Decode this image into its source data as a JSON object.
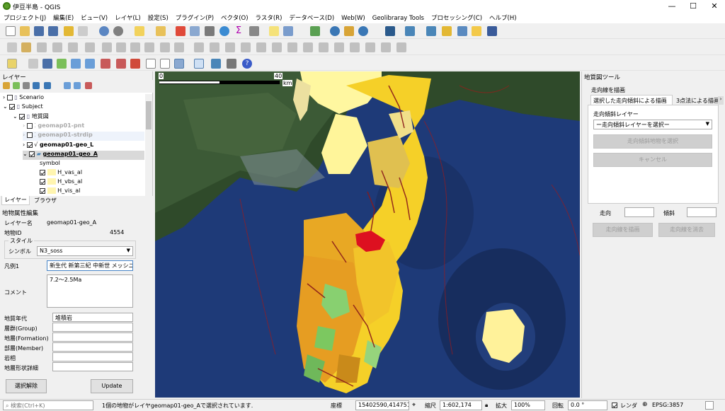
{
  "window": {
    "title": "伊豆半島 - QGIS",
    "minimize": "—",
    "maximize": "☐",
    "close": "✕"
  },
  "menu": [
    "プロジェクト(J)",
    "編集(E)",
    "ビュー(V)",
    "レイヤ(L)",
    "設定(S)",
    "プラグイン(P)",
    "ベクタ(O)",
    "ラスタ(R)",
    "データベース(D)",
    "Web(W)",
    "Geolibraray Tools",
    "プロセッシング(C)",
    "ヘルプ(H)"
  ],
  "layers_panel": {
    "title": "レイヤー",
    "tree": [
      {
        "label": "Scenario",
        "checked": false,
        "indent": 0
      },
      {
        "label": "Subject",
        "checked": true,
        "indent": 0
      },
      {
        "label": "地質図",
        "checked": true,
        "indent": 1
      },
      {
        "label": "geomap01-pnt",
        "checked": false,
        "indent": 2
      },
      {
        "label": "geomap01-strdip",
        "checked": false,
        "indent": 2
      },
      {
        "label": "geomap01-geo_L",
        "checked": true,
        "indent": 2
      },
      {
        "label": "geomap01-geo_A",
        "checked": true,
        "indent": 2
      },
      {
        "label": "symbol",
        "indent": 3
      },
      {
        "label": "H_vas_al",
        "checked": true,
        "indent": 3
      },
      {
        "label": "H_vbs_al",
        "checked": true,
        "indent": 3
      },
      {
        "label": "H_vis_al",
        "checked": true,
        "indent": 3
      }
    ],
    "tabs": [
      "レイヤー",
      "ブラウザ"
    ]
  },
  "attr_panel": {
    "title": "地物属性編集",
    "layer_name_label": "レイヤー名",
    "layer_name": "geomap01-geo_A",
    "feature_id_label": "地物ID",
    "feature_id": "4554",
    "style_label": "スタイル",
    "symbol_label": "シンボル",
    "symbol_value": "N3_soss",
    "legend_label": "凡例1",
    "legend_value": "新生代 新第三紀 中新世 メッシニ",
    "comment_label": "コメント",
    "comment_value": "7.2〜2.5Ma",
    "rows": [
      {
        "label": "地質年代",
        "value": "堆積岩"
      },
      {
        "label": "層群(Group)",
        "value": ""
      },
      {
        "label": "地層(Formation)",
        "value": ""
      },
      {
        "label": "部層(Member)",
        "value": ""
      },
      {
        "label": "岩相",
        "value": ""
      },
      {
        "label": "地層形状詳細",
        "value": ""
      }
    ],
    "clear_button": "選択解除",
    "update_button": "Update"
  },
  "map": {
    "scale_zero": "0",
    "scale_forty": "40",
    "scale_unit": "km"
  },
  "geo_tool": {
    "title": "地質図ツール",
    "section": "走向線を描画",
    "tabs": [
      "選択した走向傾斜による描画",
      "3点法による描画"
    ],
    "layer_label": "走向傾斜レイヤー",
    "layer_select": "ー走向傾斜レイヤーを選択ー",
    "select_button": "走向傾斜地物を選択",
    "cancel_button": "キャンセル",
    "strike_label": "走向",
    "dip_label": "傾斜",
    "draw_button": "走向線を描画",
    "erase_button": "走向線を消去"
  },
  "status": {
    "search_placeholder": "検索(Ctrl+K)",
    "message": "1個の地物がレイヤgeomap01-geo_Aで選択されています.",
    "coord_label": "座標",
    "coord_value": "15402590,4147519",
    "scale_label": "縮尺",
    "scale_value": "1:602,174",
    "magnify_label": "拡大",
    "magnify_value": "100%",
    "rotation_label": "回転",
    "rotation_value": "0.0 °",
    "render_label": "レンダ",
    "crs": "EPSG:3857"
  }
}
